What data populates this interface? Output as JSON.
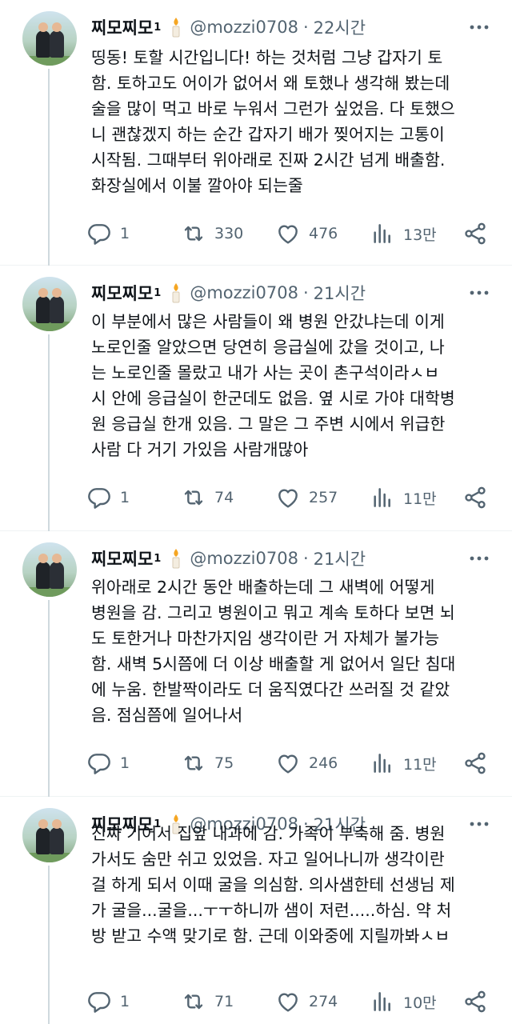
{
  "author": {
    "name": "찌모찌모",
    "sup": "1",
    "handle": "@mozzi0708",
    "separator": "·"
  },
  "colors": {
    "text": "#0f1419",
    "muted": "#536471",
    "thread_line": "#cfd9de",
    "candle_flame": "#f5a623",
    "divider": "#eff3f4"
  },
  "icons": [
    "reply-icon",
    "retweet-icon",
    "like-icon",
    "views-icon",
    "share-icon",
    "more-icon",
    "candle-icon"
  ],
  "tweets": [
    {
      "time": "22시간",
      "lines": [
        "띵동! 토할 시간입니다! 하는 것처럼 그냥 갑자기 토",
        "함. 토하고도 어이가 없어서 왜 토했나 생각해 봤는데",
        "술을 많이 먹고 바로 누워서 그런가 싶었음. 다 토했으",
        "니 괜찮겠지 하는 순간 갑자기 배가 찢어지는 고통이",
        "시작됨. 그때부터 위아래로 진짜 2시간 넘게 배출함.",
        "화장실에서 이불 깔아야 되는줄"
      ],
      "replies": "1",
      "retweets": "330",
      "likes": "476",
      "views": "13만"
    },
    {
      "time": "21시간",
      "lines": [
        "이 부분에서 많은 사람들이 왜 병원 안갔냐는데 이게",
        "노로인줄 알았으면 당연히 응급실에 갔을 것이고, 나",
        "는 노로인줄 몰랐고 내가 사는 곳이 촌구석이라ㅅㅂ",
        "시 안에 응급실이 한군데도 없음. 옆 시로 가야 대학병",
        "원 응급실 한개 있음. 그 말은 그 주변 시에서 위급한",
        "사람 다 거기 가있음 사람개많아"
      ],
      "replies": "1",
      "retweets": "74",
      "likes": "257",
      "views": "11만"
    },
    {
      "time": "21시간",
      "lines": [
        "위아래로 2시간 동안 배출하는데 그 새벽에 어떻게",
        "병원을 감. 그리고 병원이고 뭐고 계속 토하다 보면 뇌",
        "도 토한거나 마찬가지임 생각이란 거 자체가 불가능",
        "함. 새벽 5시쯤에 더 이상 배출할 게 없어서 일단 침대",
        "에 누움. 한발짝이라도 더 움직였다간 쓰러질 것 같았",
        "음. 점심쯤에 일어나서"
      ],
      "replies": "1",
      "retweets": "75",
      "likes": "246",
      "views": "11만"
    },
    {
      "time": "21시간",
      "lines": [
        "진짜 기어서 집앞 내과에 감. 가족이 부축해 줌. 병원",
        "가서도 숨만 쉬고 있었음. 자고 일어나니까 생각이란",
        "걸 하게 되서 이때 굴을 의심함. 의사샘한테 선생님 제",
        "가 굴을...굴을...ㅜㅜ하니까 샘이 저런.....하심. 약 처",
        "방 받고 수액 맞기로 함. 근데 이와중에 지릴까봐ㅅㅂ"
      ],
      "replies": "1",
      "retweets": "71",
      "likes": "274",
      "views": "10만"
    }
  ]
}
